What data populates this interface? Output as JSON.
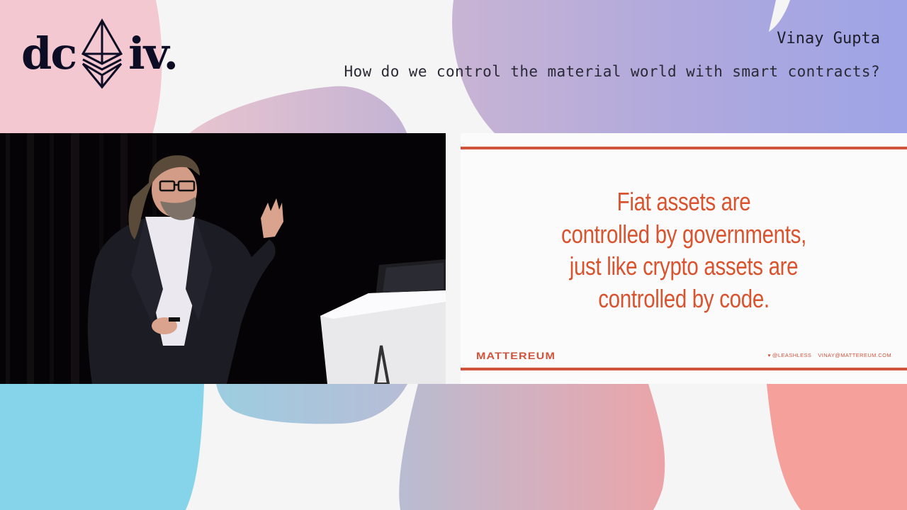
{
  "event": {
    "logo_left": "dc",
    "logo_right": "iv.",
    "logo_icon": "ethereum-diamond-icon"
  },
  "header": {
    "speaker": "Vinay Gupta",
    "talk_title": "How do we control the material world with smart contracts?"
  },
  "video": {
    "description": "speaker on stage at podium",
    "icon": "video-feed"
  },
  "slide": {
    "lines": [
      "Fiat assets are",
      "controlled by governments,",
      "just like crypto assets are",
      "controlled by code."
    ],
    "brand": "MATTEREUM",
    "twitter_icon": "heart-icon",
    "twitter": "@LEASHLESS",
    "email": "VINAY@MATTEREUM.COM",
    "accent_color": "#d0533c",
    "text_color": "#d9532f"
  },
  "theme": {
    "background": "#f5f5f6",
    "blob_pink": "#f3c8d1",
    "blob_purple": "#a3a5e6",
    "blob_cyan": "#84d4e8",
    "blob_coral": "#f59f99"
  }
}
